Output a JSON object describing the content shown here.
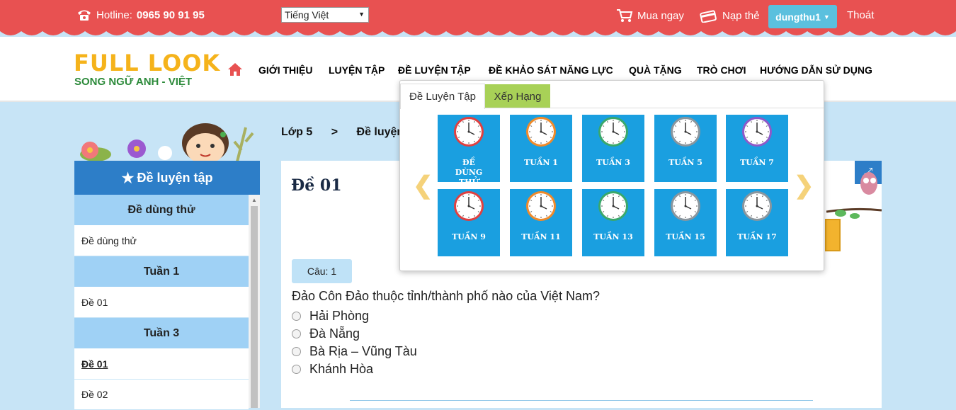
{
  "topbar": {
    "hotline_label": "Hotline:",
    "hotline_number": "0965 90 91 95",
    "language": "Tiếng Việt",
    "buy": "Mua ngay",
    "topup": "Nạp thẻ",
    "username": "dungthu1",
    "logout": "Thoát"
  },
  "logo": {
    "line1": "FULL LOOK",
    "line2": "SONG NGỮ ANH - VIỆT"
  },
  "nav": [
    {
      "label": "GIỚI THIỆU",
      "color": "#2bb3c0"
    },
    {
      "label": "LUYỆN TẬP",
      "color": "#c66fe0"
    },
    {
      "label": "ĐỀ LUYỆN TẬP",
      "color": "#f3b51c"
    },
    {
      "label": "ĐỀ KHẢO SÁT NĂNG LỰC",
      "color": "#37a64b"
    },
    {
      "label": "QUÀ TẶNG",
      "color": "#9aa7b4"
    },
    {
      "label": "TRÒ CHƠI",
      "color": "#4a6fd0"
    },
    {
      "label": "HƯỚNG DẪN SỬ DỤNG",
      "color": "#e04a5a"
    }
  ],
  "breadcrumb": {
    "level": "Lớp 5",
    "sep": ">",
    "current": "Đề luyện"
  },
  "sidebar": {
    "title": "Đề luyện tập",
    "groups": [
      {
        "title": "Đề dùng thử",
        "items": [
          {
            "label": "Đề dùng thử"
          }
        ]
      },
      {
        "title": "Tuần 1",
        "items": [
          {
            "label": "Đề 01"
          }
        ]
      },
      {
        "title": "Tuần 3",
        "items": [
          {
            "label": "Đề 01"
          },
          {
            "label": "Đề 02"
          }
        ]
      }
    ]
  },
  "main": {
    "title": "Đề 01",
    "question_label": "Câu: 1",
    "question": "Đảo Côn Đảo thuộc tỉnh/thành phố nào của Việt Nam?",
    "options": [
      "Hải Phòng",
      "Đà Nẵng",
      "Bà Rịa – Vũng Tàu",
      "Khánh Hòa"
    ]
  },
  "dropdown": {
    "tabs": [
      "Đề Luyện Tập",
      "Xếp Hạng"
    ],
    "tiles": [
      {
        "label": "ĐỀ DÙNG THỬ",
        "clock": "red"
      },
      {
        "label": "TUẦN 1",
        "clock": "orange"
      },
      {
        "label": "TUẦN 3",
        "clock": "green"
      },
      {
        "label": "TUẦN 5",
        "clock": "gray"
      },
      {
        "label": "TUẦN 7",
        "clock": "purple"
      },
      {
        "label": "TUẦN 9",
        "clock": "red"
      },
      {
        "label": "TUẦN 11",
        "clock": "orange"
      },
      {
        "label": "TUẦN 13",
        "clock": "green"
      },
      {
        "label": "TUẦN 15",
        "clock": "gray"
      },
      {
        "label": "TUẦN 17",
        "clock": "gray"
      }
    ]
  },
  "colors": {
    "topbar": "#e85151",
    "accent_blue": "#2d7ec8",
    "tile_blue": "#1a9fe0",
    "user_button": "#5bc0de"
  }
}
